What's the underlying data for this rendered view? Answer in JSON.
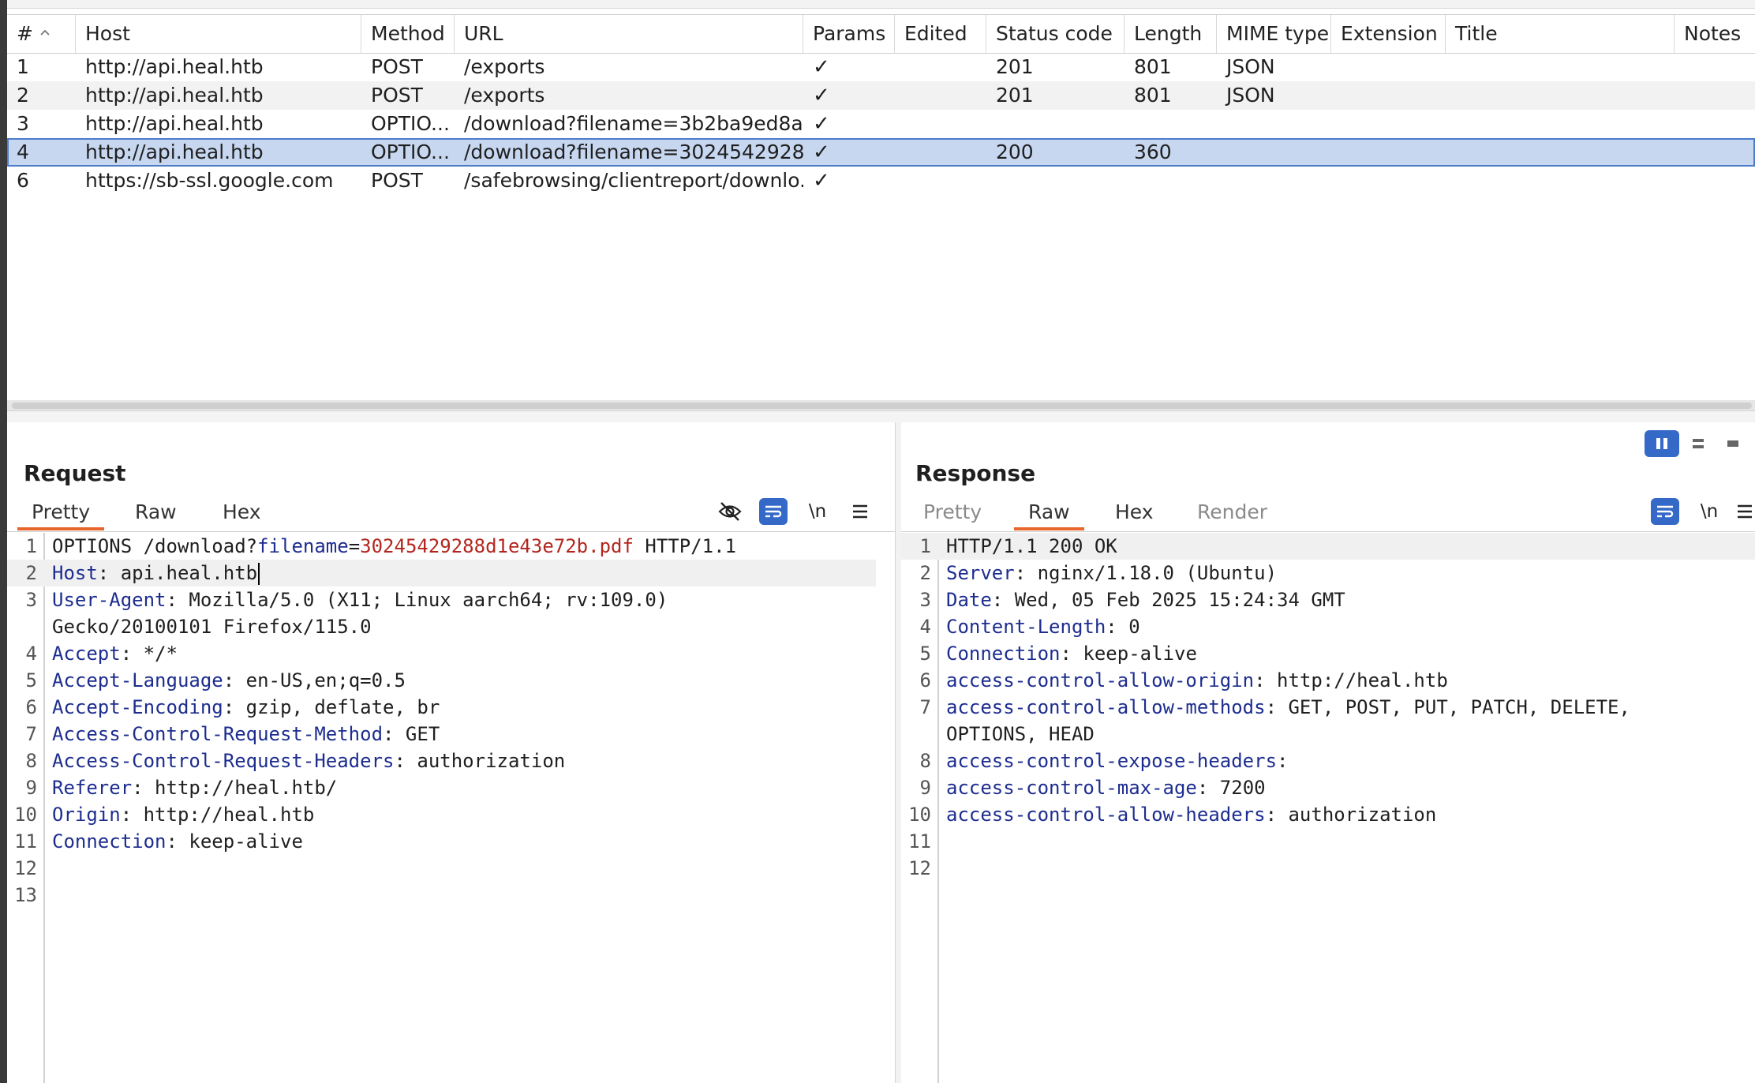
{
  "history": {
    "columns": [
      "#",
      "Host",
      "Method",
      "URL",
      "Params",
      "Edited",
      "Status code",
      "Length",
      "MIME type",
      "Extension",
      "Title",
      "Notes"
    ],
    "rows": [
      {
        "num": "1",
        "host": "http://api.heal.htb",
        "method": "POST",
        "url": "/exports",
        "params": "✓",
        "edited": "",
        "status": "201",
        "length": "801",
        "mime": "JSON",
        "extension": "",
        "title": "",
        "notes": ""
      },
      {
        "num": "2",
        "host": "http://api.heal.htb",
        "method": "POST",
        "url": "/exports",
        "params": "✓",
        "edited": "",
        "status": "201",
        "length": "801",
        "mime": "JSON",
        "extension": "",
        "title": "",
        "notes": ""
      },
      {
        "num": "3",
        "host": "http://api.heal.htb",
        "method": "OPTIO...",
        "url": "/download?filename=3b2ba9ed8aa...",
        "params": "✓",
        "edited": "",
        "status": "",
        "length": "",
        "mime": "",
        "extension": "",
        "title": "",
        "notes": ""
      },
      {
        "num": "4",
        "host": "http://api.heal.htb",
        "method": "OPTIO...",
        "url": "/download?filename=3024542928...",
        "params": "✓",
        "edited": "",
        "status": "200",
        "length": "360",
        "mime": "",
        "extension": "",
        "title": "",
        "notes": ""
      },
      {
        "num": "6",
        "host": "https://sb-ssl.google.com",
        "method": "POST",
        "url": "/safebrowsing/clientreport/downlo...",
        "params": "✓",
        "edited": "",
        "status": "",
        "length": "",
        "mime": "",
        "extension": "",
        "title": "",
        "notes": ""
      }
    ],
    "selected_row": "4"
  },
  "request": {
    "title": "Request",
    "tabs": [
      "Pretty",
      "Raw",
      "Hex"
    ],
    "active_tab": "Pretty",
    "line_numbers": [
      "1",
      "2",
      "3",
      "",
      "4",
      "5",
      "6",
      "7",
      "8",
      "9",
      "10",
      "11",
      "12",
      "13"
    ],
    "line1": {
      "method_path": "OPTIONS /download?",
      "param_key": "filename",
      "eq": "=",
      "param_value": "30245429288d1e43e72b.pdf",
      "version": " HTTP/1.1"
    },
    "headers": [
      {
        "key": "Host",
        "value": ": api.heal.htb"
      },
      {
        "key": "User-Agent",
        "value": ": Mozilla/5.0 (X11; Linux aarch64; rv:109.0)"
      },
      {
        "key": "",
        "value": "Gecko/20100101 Firefox/115.0"
      },
      {
        "key": "Accept",
        "value": ": */*"
      },
      {
        "key": "Accept-Language",
        "value": ": en-US,en;q=0.5"
      },
      {
        "key": "Accept-Encoding",
        "value": ": gzip, deflate, br"
      },
      {
        "key": "Access-Control-Request-Method",
        "value": ": GET"
      },
      {
        "key": "Access-Control-Request-Headers",
        "value": ": authorization"
      },
      {
        "key": "Referer",
        "value": ": http://heal.htb/"
      },
      {
        "key": "Origin",
        "value": ": http://heal.htb"
      },
      {
        "key": "Connection",
        "value": ": keep-alive"
      }
    ],
    "icons": [
      "eye-slash-icon",
      "wrap-icon",
      "newline-icon",
      "menu-icon"
    ],
    "newline_label": "\\n"
  },
  "response": {
    "title": "Response",
    "tabs": [
      "Pretty",
      "Raw",
      "Hex",
      "Render"
    ],
    "active_tab": "Raw",
    "line_numbers": [
      "1",
      "2",
      "3",
      "4",
      "5",
      "6",
      "7",
      "",
      "8",
      "9",
      "10",
      "11",
      "12"
    ],
    "status_line": "HTTP/1.1 200 OK",
    "headers": [
      {
        "key": "Server",
        "value": ": nginx/1.18.0 (Ubuntu)"
      },
      {
        "key": "Date",
        "value": ": Wed, 05 Feb 2025 15:24:34 GMT"
      },
      {
        "key": "Content-Length",
        "value": ": 0"
      },
      {
        "key": "Connection",
        "value": ": keep-alive"
      },
      {
        "key": "access-control-allow-origin",
        "value": ": http://heal.htb"
      },
      {
        "key": "access-control-allow-methods",
        "value": ": GET, POST, PUT, PATCH, DELETE,"
      },
      {
        "key": "",
        "value": "OPTIONS, HEAD"
      },
      {
        "key": "access-control-expose-headers",
        "value": ":"
      },
      {
        "key": "access-control-max-age",
        "value": ": 7200"
      },
      {
        "key": "access-control-allow-headers",
        "value": ": authorization"
      }
    ],
    "newline_label": "\\n"
  },
  "colors": {
    "accent_tab": "#e8662b",
    "selection": "#c7d7f0",
    "header_key": "#1d2d8f",
    "param_value": "#b3261e",
    "blue_button": "#3569c7"
  }
}
